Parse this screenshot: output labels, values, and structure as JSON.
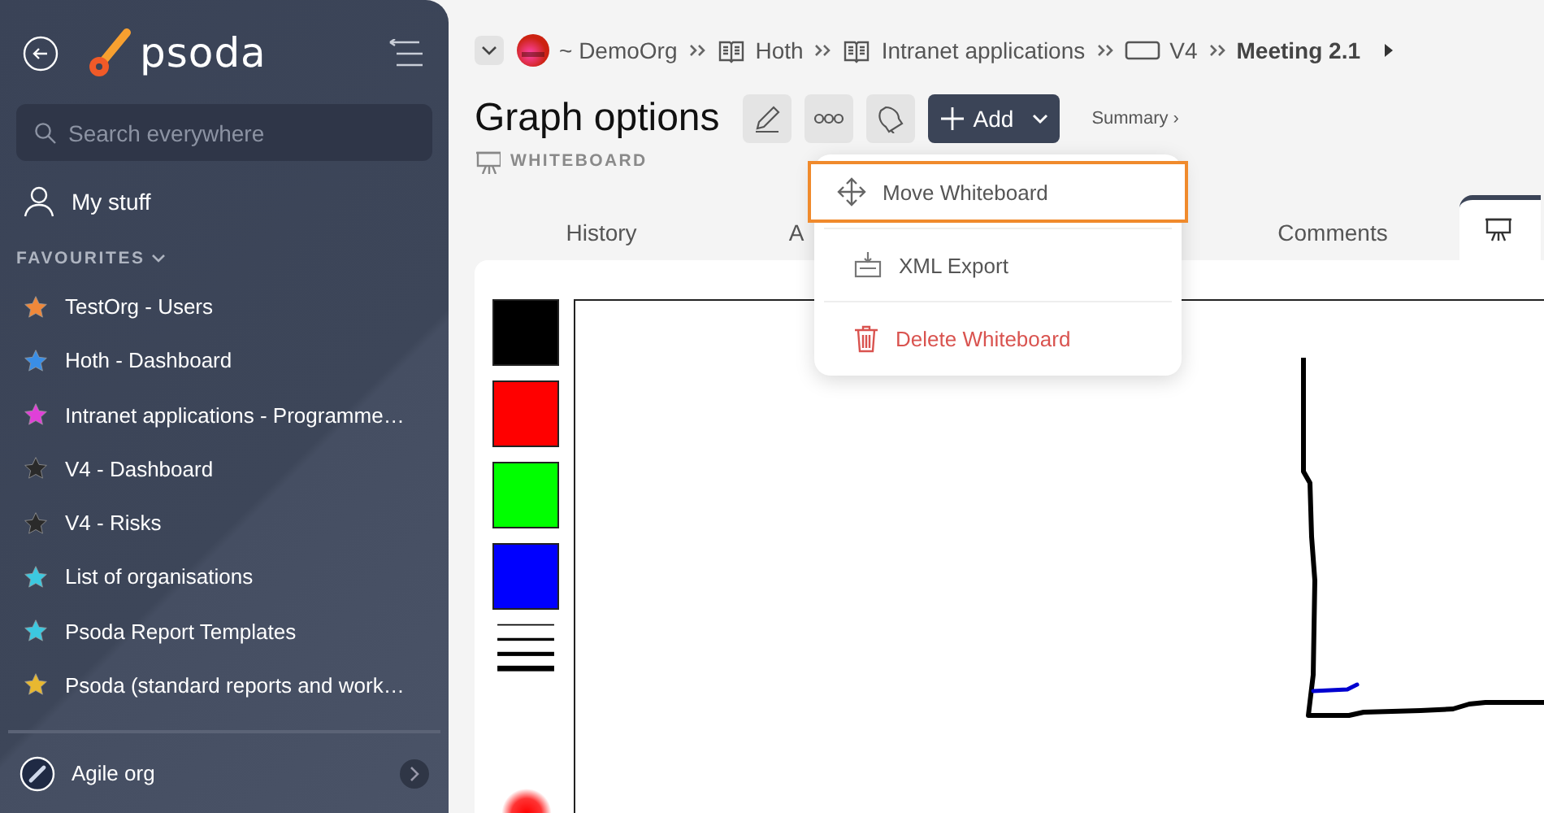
{
  "sidebar": {
    "logo": "psoda",
    "search": {
      "placeholder": "Search everywhere"
    },
    "my_stuff": "My stuff",
    "favourites_label": "FAVOURITES",
    "favourites_expanded": true,
    "favourites": [
      {
        "label": "TestOrg - Users",
        "color": "#f0883a"
      },
      {
        "label": "Hoth - Dashboard",
        "color": "#3a8ee6"
      },
      {
        "label": "Intranet applications - Programme…",
        "color": "#e040d8"
      },
      {
        "label": "V4 - Dashboard",
        "color": "#2a2a2a"
      },
      {
        "label": "V4 - Risks",
        "color": "#2a2a2a"
      },
      {
        "label": "List of organisations",
        "color": "#3cc8e0"
      },
      {
        "label": "Psoda Report Templates",
        "color": "#3cc8e0"
      },
      {
        "label": "Psoda (standard reports and work…",
        "color": "#e8b830"
      }
    ],
    "organisation": "Agile org"
  },
  "breadcrumb": [
    {
      "kind": "org",
      "label": "~ DemoOrg"
    },
    {
      "kind": "book",
      "label": "Hoth"
    },
    {
      "kind": "book",
      "label": "Intranet applications"
    },
    {
      "kind": "board",
      "label": "V4"
    },
    {
      "kind": "current",
      "label": "Meeting 2.1"
    }
  ],
  "page": {
    "title": "Graph options",
    "type_label": "WHITEBOARD",
    "add_button": "Add",
    "summary_link": "Summary ›"
  },
  "menu": [
    {
      "kind": "move",
      "label": "Move Whiteboard",
      "highlighted": true
    },
    {
      "kind": "export",
      "label": "XML Export",
      "highlighted": false
    },
    {
      "kind": "delete",
      "label": "Delete Whiteboard",
      "highlighted": false
    }
  ],
  "tabs": [
    {
      "kind": "text",
      "label": "History",
      "selected": false
    },
    {
      "kind": "text",
      "label": "A",
      "selected": false
    },
    {
      "kind": "gap"
    },
    {
      "kind": "text",
      "label": "Comments",
      "selected": false
    },
    {
      "kind": "icon",
      "selected": true
    }
  ],
  "palette": [
    {
      "color": "#000000"
    },
    {
      "color": "#ff0000"
    },
    {
      "color": "#00ff00"
    },
    {
      "color": "#0000ff"
    }
  ]
}
